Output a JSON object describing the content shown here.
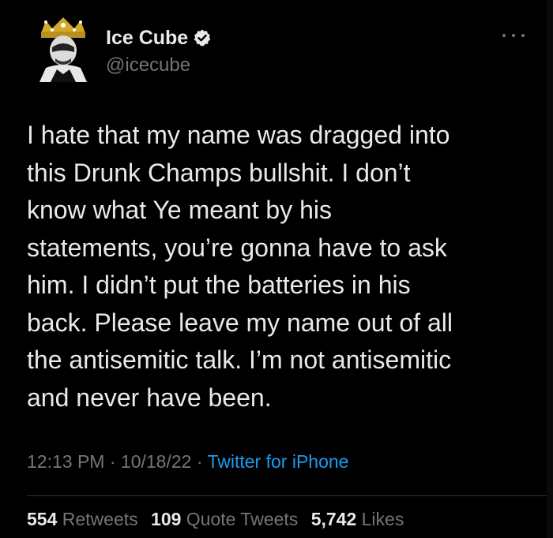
{
  "author": {
    "name": "Ice Cube",
    "handle": "@icecube",
    "verified": true,
    "avatar_icon": "crowned-profile-avatar"
  },
  "tweet": {
    "text": "I hate that my name was dragged into\nthis Drunk Champs bullshit. I don’t\nknow what Ye meant by his\nstatements, you’re gonna have to ask\nhim. I didn’t put the batteries in his\nback. Please leave my name out of all\nthe antisemitic talk. I’m not antisemitic\nand never have been."
  },
  "meta": {
    "time": "12:13 PM",
    "separator": "·",
    "date": "10/18/22",
    "source": "Twitter for iPhone"
  },
  "stats": {
    "retweets_count": "554",
    "retweets_label": "Retweets",
    "quotes_count": "109",
    "quotes_label": "Quote Tweets",
    "likes_count": "5,742",
    "likes_label": "Likes"
  },
  "colors": {
    "background": "#000000",
    "text": "#e7e9ea",
    "secondary": "#71767b",
    "link": "#1d9bf0",
    "crown": "#d4a82a"
  },
  "icons": {
    "more": "more-horizontal-icon",
    "verified": "verified-badge-icon"
  }
}
